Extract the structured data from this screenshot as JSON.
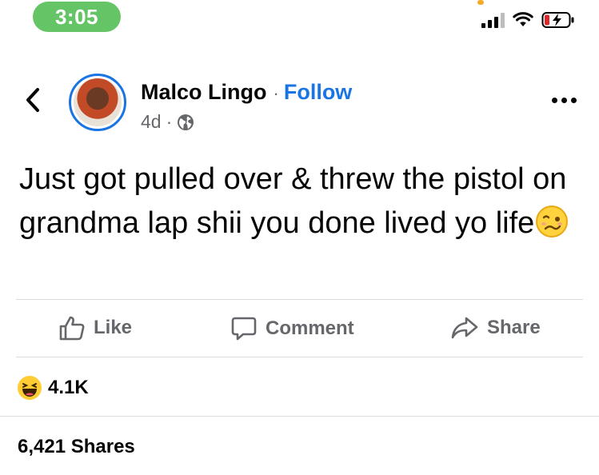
{
  "status_bar": {
    "time": "3:05",
    "icons": [
      "cellular-signal-icon",
      "wifi-icon",
      "battery-charging-icon"
    ]
  },
  "header": {
    "back_icon": "chevron-left-icon",
    "author_name": "Malco Lingo",
    "separator": "·",
    "follow_label": "Follow",
    "timestamp": "4d",
    "meta_separator": "·",
    "audience_icon": "globe-icon",
    "more_icon": "more-dots-icon"
  },
  "post": {
    "text": "Just got pulled over & threw the pistol on grandma lap shii you done lived yo life",
    "trailing_emoji": "woozy-face-emoji"
  },
  "actions": {
    "like_label": "Like",
    "comment_label": "Comment",
    "share_label": "Share"
  },
  "reactions": {
    "icon": "haha-reaction-icon",
    "count": "4.1K"
  },
  "shares": {
    "label": "6,421 Shares"
  },
  "colors": {
    "accent": "#1b74e4",
    "time_pill": "#65c466",
    "secondary_text": "#65676b",
    "divider": "#d9dbdf"
  }
}
